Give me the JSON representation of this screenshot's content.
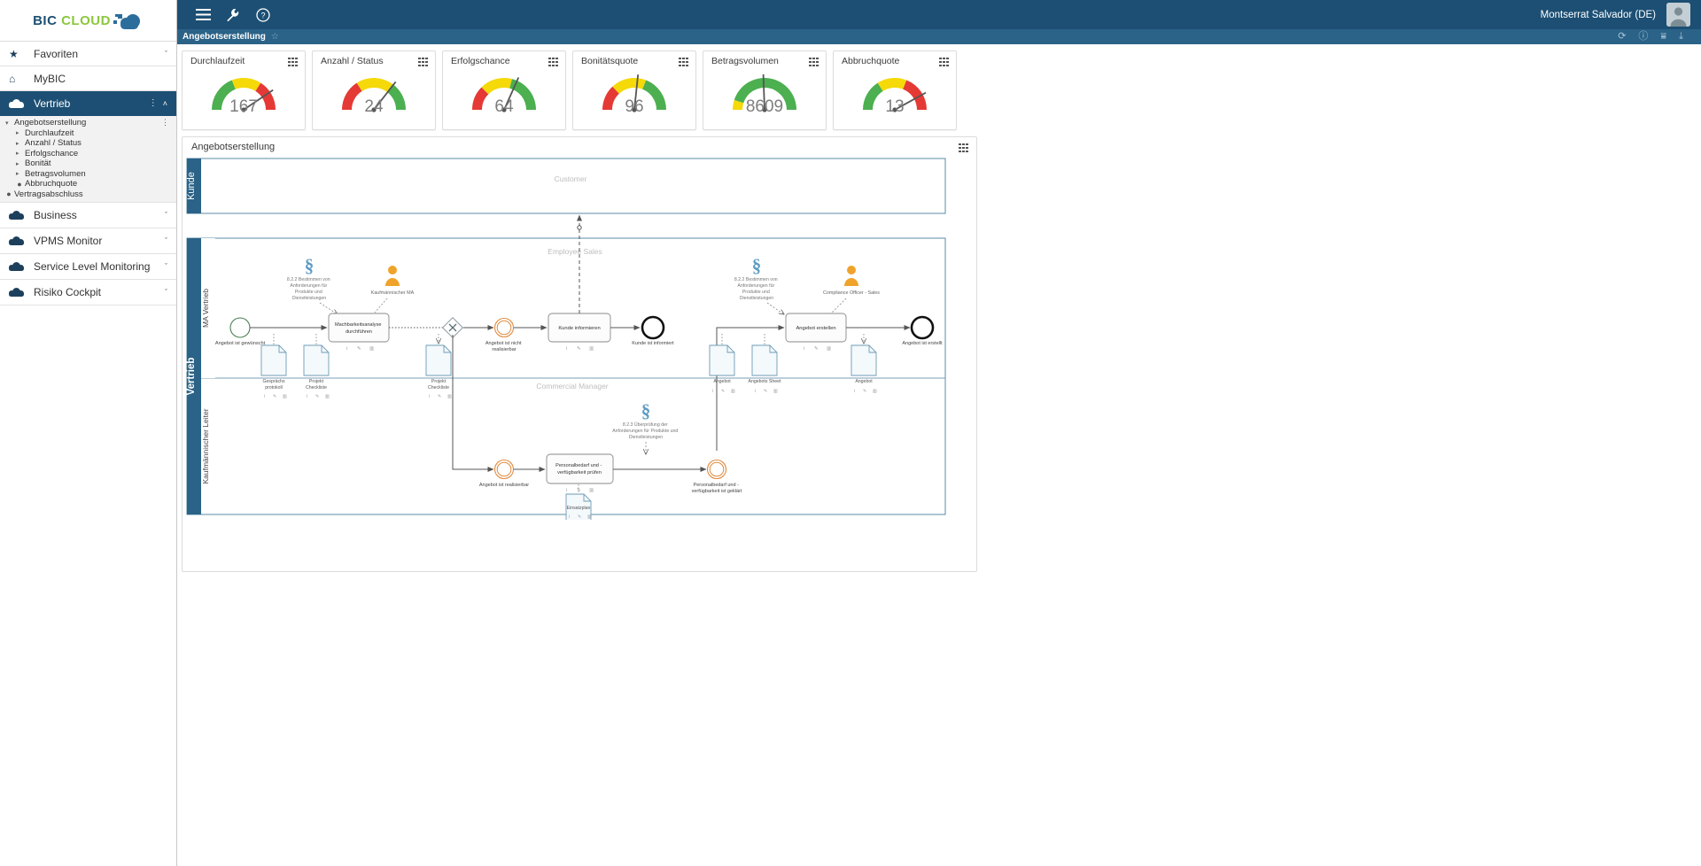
{
  "app": {
    "logo_bic": "BIC",
    "logo_cloud": "CLOUD",
    "user": "Montserrat Salvador  (DE)"
  },
  "topbar": {
    "menu_icon": "hamburger-icon",
    "tools_icon": "wrench-icon",
    "help_icon": "question-circle-icon"
  },
  "tab": {
    "title": "Angebotserstellung",
    "star": "☆",
    "actions": [
      "refresh-icon",
      "info-icon",
      "filter-icon",
      "download-icon"
    ]
  },
  "sidebar": {
    "items": [
      {
        "label": "Favoriten",
        "icon": "star-icon",
        "chevron": "ˇ",
        "active": false
      },
      {
        "label": "MyBIC",
        "icon": "home-icon",
        "chevron": "",
        "active": false
      },
      {
        "label": "Vertrieb",
        "icon": "cloud-icon",
        "chevron": "˄",
        "active": true
      },
      {
        "label": "Business",
        "icon": "cloud-icon",
        "chevron": "ˇ",
        "active": false
      },
      {
        "label": "VPMS Monitor",
        "icon": "cloud-icon",
        "chevron": "ˇ",
        "active": false
      },
      {
        "label": "Service Level Monitoring",
        "icon": "cloud-icon",
        "chevron": "ˇ",
        "active": false
      },
      {
        "label": "Risiko Cockpit",
        "icon": "cloud-icon",
        "chevron": "ˇ",
        "active": false
      }
    ],
    "tree": [
      {
        "label": "Angebotserstellung",
        "level": 0,
        "marker": "▾",
        "menu": true
      },
      {
        "label": "Durchlaufzeit",
        "level": 1,
        "marker": "▸",
        "menu": false
      },
      {
        "label": "Anzahl / Status",
        "level": 1,
        "marker": "▸",
        "menu": false
      },
      {
        "label": "Erfolgschance",
        "level": 1,
        "marker": "▸",
        "menu": false
      },
      {
        "label": "Bonität",
        "level": 1,
        "marker": "▸",
        "menu": false
      },
      {
        "label": "Betragsvolumen",
        "level": 1,
        "marker": "▸",
        "menu": false
      },
      {
        "label": "Abbruchquote",
        "level": 1,
        "marker": "●",
        "menu": false
      },
      {
        "label": "Vertragsabschluss",
        "level": 0,
        "marker": "●",
        "menu": false
      }
    ]
  },
  "gauges": [
    {
      "title": "Durchlaufzeit",
      "value": "167",
      "needle_deg": 146,
      "bands": [
        {
          "color": "#4caf50",
          "from": 0,
          "to": 38
        },
        {
          "color": "#f5d908",
          "from": 38,
          "to": 68
        },
        {
          "color": "#e53935",
          "from": 68,
          "to": 100
        }
      ]
    },
    {
      "title": "Anzahl / Status",
      "value": "24",
      "needle_deg": 128,
      "bands": [
        {
          "color": "#e53935",
          "from": 0,
          "to": 32
        },
        {
          "color": "#f5d908",
          "from": 32,
          "to": 70
        },
        {
          "color": "#4caf50",
          "from": 70,
          "to": 100
        }
      ]
    },
    {
      "title": "Erfolgschance",
      "value": "64",
      "needle_deg": 114,
      "bands": [
        {
          "color": "#e53935",
          "from": 0,
          "to": 25
        },
        {
          "color": "#f5d908",
          "from": 25,
          "to": 58
        },
        {
          "color": "#4caf50",
          "from": 58,
          "to": 100
        }
      ]
    },
    {
      "title": "Bonitätsquote",
      "value": "96",
      "needle_deg": 96,
      "bands": [
        {
          "color": "#e53935",
          "from": 0,
          "to": 26
        },
        {
          "color": "#f5d908",
          "from": 26,
          "to": 62
        },
        {
          "color": "#4caf50",
          "from": 62,
          "to": 100
        }
      ]
    },
    {
      "title": "Betragsvolumen",
      "value": "8609",
      "needle_deg": 88,
      "bands": [
        {
          "color": "#f5d908",
          "from": 0,
          "to": 10
        },
        {
          "color": "#4caf50",
          "from": 10,
          "to": 100
        }
      ]
    },
    {
      "title": "Abbruchquote",
      "value": "13",
      "needle_deg": 151,
      "bands": [
        {
          "color": "#4caf50",
          "from": 0,
          "to": 32
        },
        {
          "color": "#f5d908",
          "from": 32,
          "to": 62
        },
        {
          "color": "#e53935",
          "from": 62,
          "to": 100
        }
      ]
    }
  ],
  "diagram": {
    "title": "Angebotserstellung",
    "pools": [
      {
        "name": "Kunde",
        "sublanes": [
          {
            "name": "Customer"
          }
        ]
      },
      {
        "name": "Vertrieb",
        "sublanes": [
          {
            "name": "MA Vertrieb",
            "header": "Employee Sales"
          },
          {
            "name": "Kaufmännischer Leiter",
            "header": "Commercial Manager"
          }
        ]
      }
    ],
    "annotations": [
      {
        "id": "ann1",
        "symbol": "§",
        "text": "8.2.2 Bestimmen von Anforderungen für Produkte und Dienstleistungen"
      },
      {
        "id": "ann2",
        "symbol": "§",
        "text": "8.2.2 Bestimmen von Anforderungen für Produkte und Dienstleistungen"
      },
      {
        "id": "ann3",
        "symbol": "§",
        "text": "8.2.3 Überprüfung der Anforderungen für Produkte und Dienstleistungen"
      }
    ],
    "roles": [
      {
        "id": "role1",
        "label": "Kaufmännischer MA"
      },
      {
        "id": "role2",
        "label": "Compliance Officer - Sales"
      }
    ],
    "events": [
      {
        "id": "ev_start",
        "label": "Angebot ist gewünscht",
        "type": "start"
      },
      {
        "id": "ev_nichtreal",
        "label": "Angebot ist nicht\nrealisierbar",
        "type": "intermediate"
      },
      {
        "id": "ev_end1",
        "label": "Kunde ist informiert",
        "type": "end"
      },
      {
        "id": "ev_end2",
        "label": "Angebot ist erstellt",
        "type": "end"
      },
      {
        "id": "ev_real",
        "label": "Angebot ist realisierbar",
        "type": "intermediate"
      },
      {
        "id": "ev_geklaert",
        "label": "Personalbedarf und -\nverfügbarkeit ist geklärt",
        "type": "intermediate"
      }
    ],
    "tasks": [
      {
        "id": "t1",
        "label": "Machbarkeitsanalyse durchführen"
      },
      {
        "id": "t2",
        "label": "Kunde informieren"
      },
      {
        "id": "t3",
        "label": "Angebot erstellen"
      },
      {
        "id": "t4",
        "label": "Personalbedarf und -\nverfügbarkeit prüfen"
      }
    ],
    "documents": [
      {
        "id": "d1",
        "label": "Gesprächs\nprotokoll"
      },
      {
        "id": "d2",
        "label": "Projekt\nCheckliste"
      },
      {
        "id": "d3",
        "label": "Projekt\nCheckliste"
      },
      {
        "id": "d4",
        "label": "Angebot"
      },
      {
        "id": "d5",
        "label": "Angebots Sheet"
      },
      {
        "id": "d6",
        "label": "Angebot"
      },
      {
        "id": "d7",
        "label": "Einsatzplan"
      }
    ],
    "item_icons": [
      "info-icon",
      "attachment-icon",
      "chart-icon"
    ]
  }
}
